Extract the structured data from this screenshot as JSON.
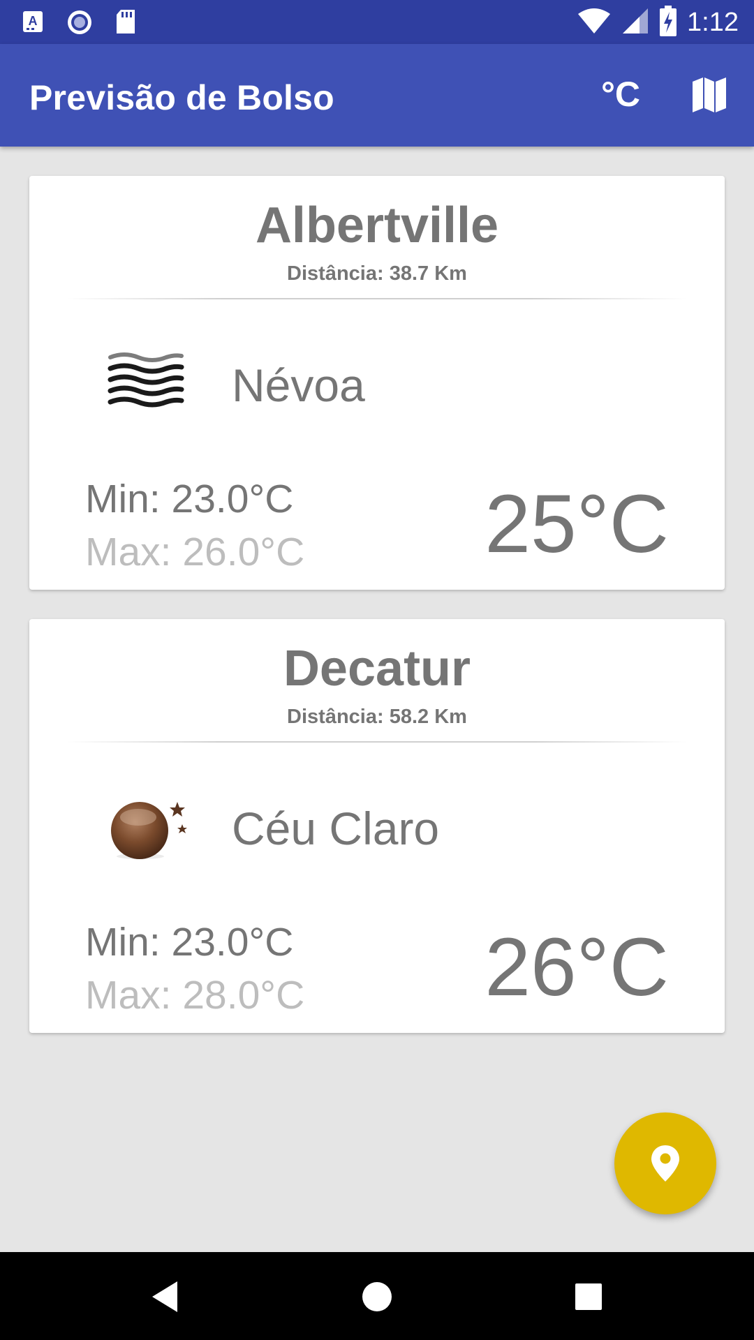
{
  "status_bar": {
    "time": "1:12",
    "icons": [
      "a-notification-icon",
      "radio-icon",
      "sd-card-icon",
      "wifi-icon",
      "signal-icon",
      "battery-charging-icon"
    ]
  },
  "app_bar": {
    "title": "Previsão de Bolso",
    "unit_label": "°C",
    "map_icon": "map-icon"
  },
  "cards": [
    {
      "city": "Albertville",
      "distance": "Distância: 38.7 Km",
      "condition": "Névoa",
      "icon": "fog-icon",
      "min": "Min: 23.0°C",
      "max": "Max: 26.0°C",
      "current": "25°C"
    },
    {
      "city": "Decatur",
      "distance": "Distância: 58.2 Km",
      "condition": "Céu Claro",
      "icon": "moon-stars-icon",
      "min": "Min: 23.0°C",
      "max": "Max: 28.0°C",
      "current": "26°C"
    }
  ],
  "fab": {
    "icon": "location-pin-icon",
    "color": "#dfb800"
  },
  "colors": {
    "status_bar": "#2f3ea0",
    "app_bar": "#3f51b5",
    "background": "#e5e5e5",
    "text_primary": "#757575",
    "text_secondary": "#bdbdbd"
  },
  "nav_bar": {
    "icons": [
      "back-icon",
      "home-icon",
      "recents-icon"
    ]
  }
}
